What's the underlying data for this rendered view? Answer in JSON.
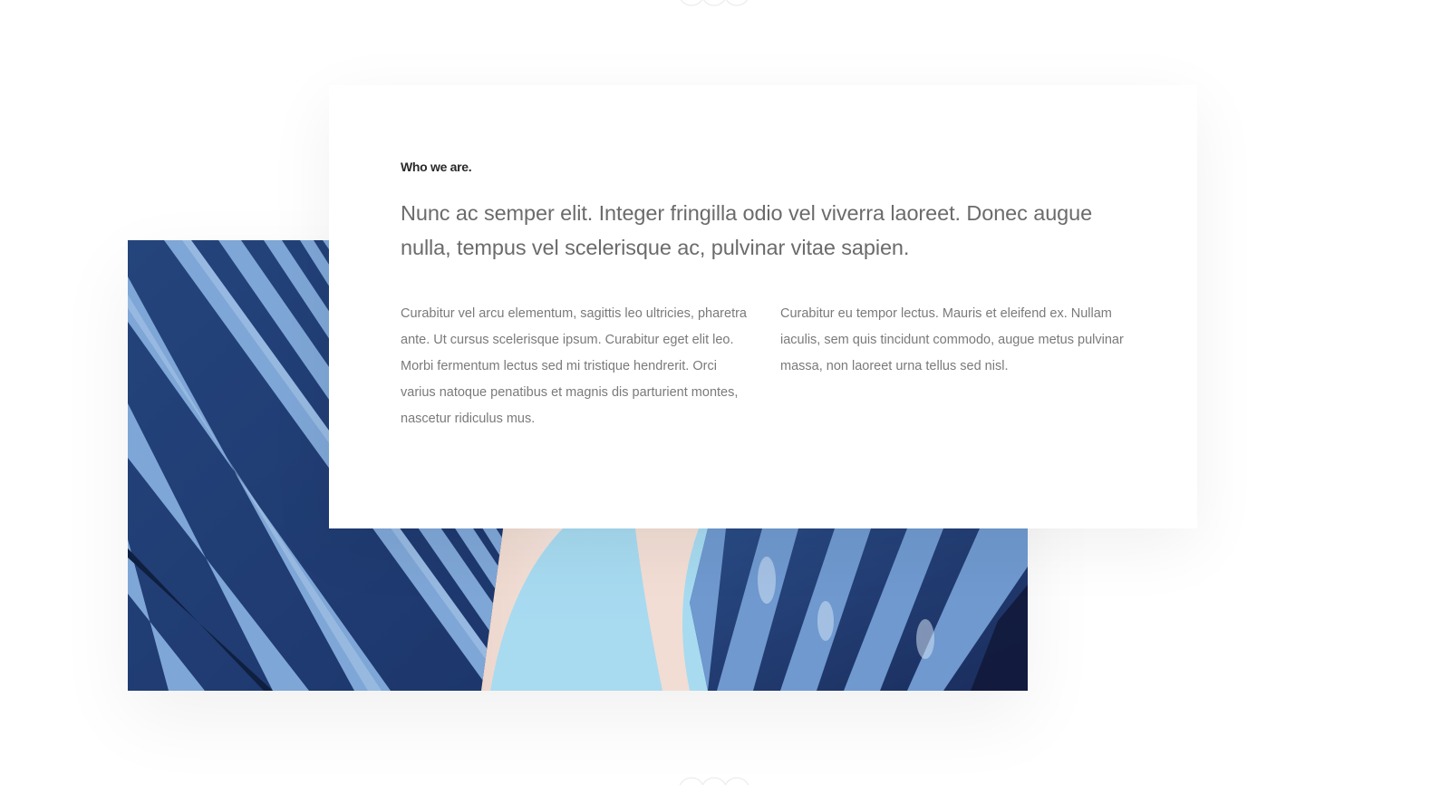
{
  "about": {
    "eyebrow": "Who we are.",
    "lead": "Nunc ac semper elit. Integer fringilla odio vel viverra laoreet. Donec augue nulla, tempus vel scelerisque ac, pulvinar vitae sapien.",
    "column_left": "Curabitur vel arcu elementum, sagittis leo ultricies, pharetra ante. Ut cursus scelerisque ipsum. Curabitur eget elit leo. Morbi fermentum lectus sed mi tristique hendrerit. Orci varius natoque penatibus et magnis dis parturient montes, nascetur ridiculus mus.",
    "column_right": "Curabitur eu tempor lectus. Mauris et eleifend ex. Nullam iaculis, sem quis tincidunt commodo, augue metus pulvinar massa, non laoreet urna tellus sed nisl."
  },
  "image": {
    "subject": "architecture-building-image"
  },
  "colors": {
    "text_dark": "#2a2a2a",
    "text_lead": "#6b6b6b",
    "text_body": "#7a7a7a",
    "building_navy": "#22417a",
    "building_light": "#7fa6d8",
    "sky": "#9fd3ec"
  }
}
